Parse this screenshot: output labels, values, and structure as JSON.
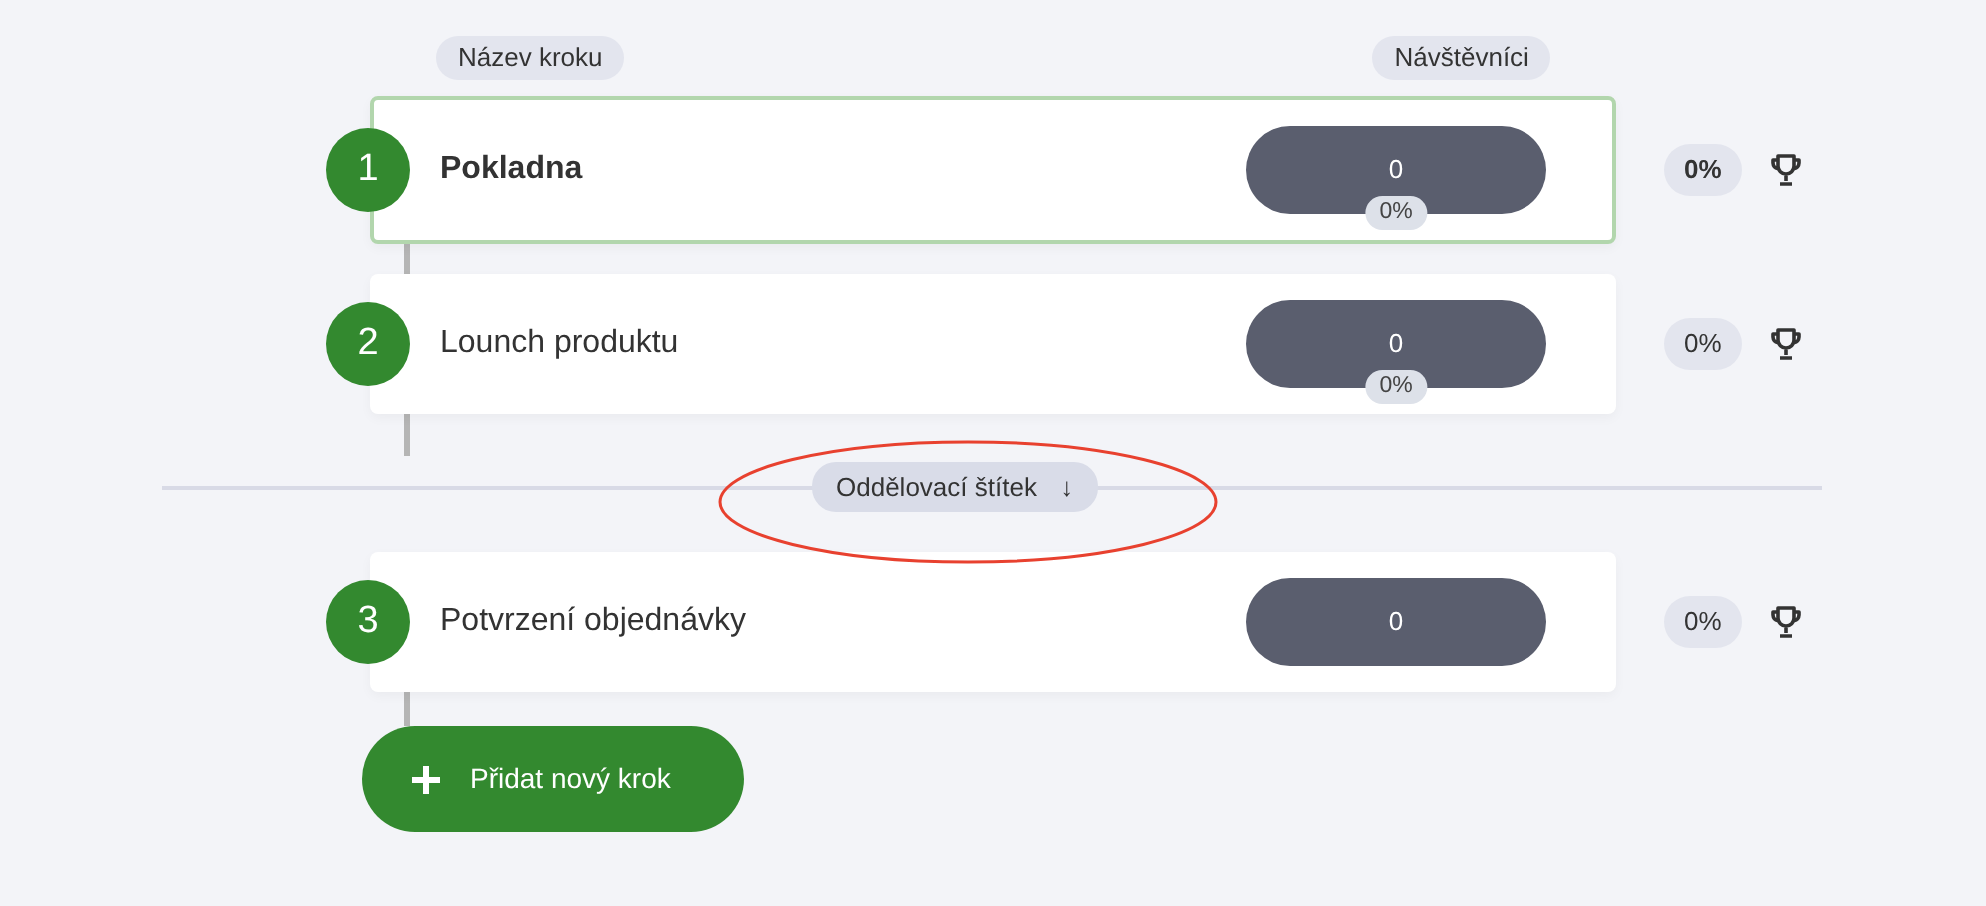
{
  "columns": [
    {
      "label": "Název kroku"
    },
    {
      "label": "Návštěvníci"
    }
  ],
  "items": [
    {
      "kind": "step",
      "number": "1",
      "name": "Pokladna",
      "selected": true,
      "visitors": "0",
      "visitors_share": "0%",
      "conversion": "0%"
    },
    {
      "kind": "step",
      "number": "2",
      "name": "Lounch produktu",
      "selected": false,
      "visitors": "0",
      "visitors_share": "0%",
      "conversion": "0%"
    },
    {
      "kind": "divider",
      "label": "Oddělovací štítek",
      "arrow": "↓",
      "circled": true
    },
    {
      "kind": "step",
      "number": "3",
      "name": "Potvrzení objednávky",
      "selected": false,
      "visitors": "0",
      "conversion": "0%"
    }
  ],
  "add_button": {
    "label": "Přidat nový krok"
  }
}
